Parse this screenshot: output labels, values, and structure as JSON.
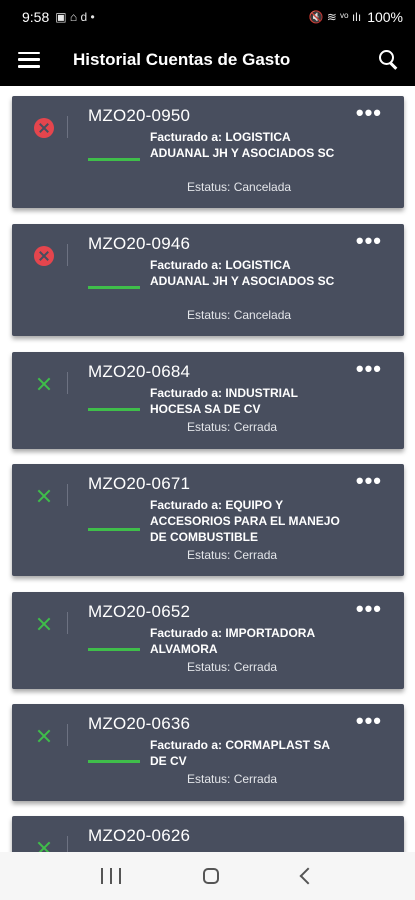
{
  "statusbar": {
    "time": "9:58",
    "left_icons": "▣ ⌂ d •",
    "right_icons": "🔇 ≋ ᵛᵒ ılı",
    "battery": "100%"
  },
  "appbar": {
    "title": "Historial Cuentas de Gasto"
  },
  "cards": [
    {
      "code": "MZO20-0950",
      "billed": "Facturado a: LOGISTICA ADUANAL JH Y ASOCIADOS SC",
      "status": "Estatus: Cancelada",
      "state": "cancel",
      "more": "•••"
    },
    {
      "code": "MZO20-0946",
      "billed": "Facturado a: LOGISTICA ADUANAL JH Y ASOCIADOS SC",
      "status": "Estatus: Cancelada",
      "state": "cancel",
      "more": "•••"
    },
    {
      "code": "MZO20-0684",
      "billed": "Facturado a: INDUSTRIAL HOCESA SA DE CV",
      "status": "Estatus: Cerrada",
      "state": "closed",
      "more": "•••"
    },
    {
      "code": "MZO20-0671",
      "billed": "Facturado a: EQUIPO Y ACCESORIOS PARA EL MANEJO DE COMBUSTIBLE",
      "status": "Estatus: Cerrada",
      "state": "closed",
      "more": "•••"
    },
    {
      "code": "MZO20-0652",
      "billed": "Facturado a: IMPORTADORA ALVAMORA",
      "status": "Estatus: Cerrada",
      "state": "closed",
      "more": "•••"
    },
    {
      "code": "MZO20-0636",
      "billed": "Facturado a: CORMAPLAST SA DE CV",
      "status": "Estatus: Cerrada",
      "state": "closed",
      "more": "•••"
    },
    {
      "code": "MZO20-0626",
      "billed": "",
      "status": "",
      "state": "closed",
      "more": ""
    }
  ]
}
